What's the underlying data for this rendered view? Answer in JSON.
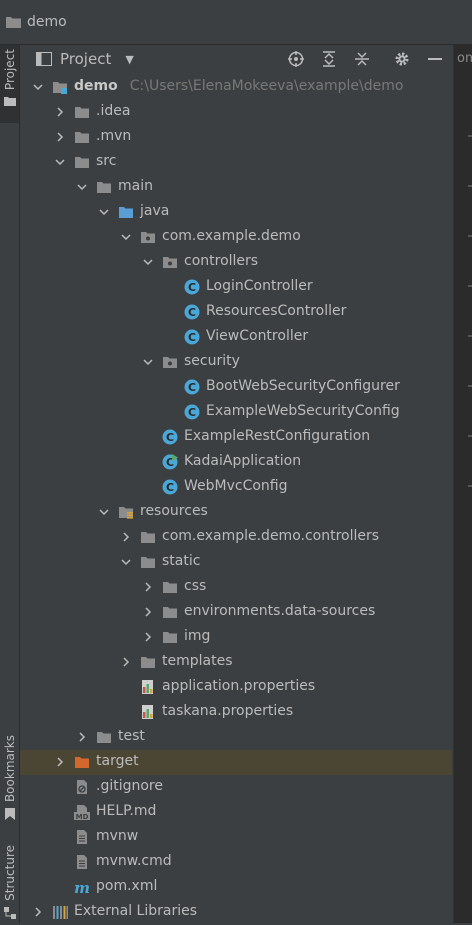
{
  "window": {
    "title": "demo"
  },
  "sidebar": {
    "project_label": "Project",
    "bookmarks_label": "Bookmarks",
    "structure_label": "Structure"
  },
  "panel": {
    "title": "Project"
  },
  "editor": {
    "tab_text": "om"
  },
  "tree": [
    {
      "label": "demo",
      "path": "C:\\Users\\ElenaMokeeva\\example\\demo",
      "icon": "module-folder-icon",
      "depth": 0,
      "arrow": "down",
      "bold": true
    },
    {
      "label": ".idea",
      "icon": "folder-icon",
      "depth": 1,
      "arrow": "right"
    },
    {
      "label": ".mvn",
      "icon": "folder-icon",
      "depth": 1,
      "arrow": "right"
    },
    {
      "label": "src",
      "icon": "folder-icon",
      "depth": 1,
      "arrow": "down"
    },
    {
      "label": "main",
      "icon": "folder-icon",
      "depth": 2,
      "arrow": "down"
    },
    {
      "label": "java",
      "icon": "source-folder-icon",
      "depth": 3,
      "arrow": "down"
    },
    {
      "label": "com.example.demo",
      "icon": "package-icon",
      "depth": 4,
      "arrow": "down"
    },
    {
      "label": "controllers",
      "icon": "package-icon",
      "depth": 5,
      "arrow": "down"
    },
    {
      "label": "LoginController",
      "icon": "java-class-icon",
      "depth": 6,
      "arrow": "none"
    },
    {
      "label": "ResourcesController",
      "icon": "java-class-icon",
      "depth": 6,
      "arrow": "none"
    },
    {
      "label": "ViewController",
      "icon": "java-class-icon",
      "depth": 6,
      "arrow": "none"
    },
    {
      "label": "security",
      "icon": "package-icon",
      "depth": 5,
      "arrow": "down"
    },
    {
      "label": "BootWebSecurityConfigurer",
      "icon": "java-class-icon",
      "depth": 6,
      "arrow": "none"
    },
    {
      "label": "ExampleWebSecurityConfig",
      "icon": "java-class-icon",
      "depth": 6,
      "arrow": "none"
    },
    {
      "label": "ExampleRestConfiguration",
      "icon": "java-class-icon",
      "depth": 5,
      "arrow": "none"
    },
    {
      "label": "KadaiApplication",
      "icon": "java-run-class-icon",
      "depth": 5,
      "arrow": "none"
    },
    {
      "label": "WebMvcConfig",
      "icon": "java-class-icon",
      "depth": 5,
      "arrow": "none"
    },
    {
      "label": "resources",
      "icon": "resources-folder-icon",
      "depth": 3,
      "arrow": "down"
    },
    {
      "label": "com.example.demo.controllers",
      "icon": "folder-icon",
      "depth": 4,
      "arrow": "right"
    },
    {
      "label": "static",
      "icon": "folder-icon",
      "depth": 4,
      "arrow": "down"
    },
    {
      "label": "css",
      "icon": "folder-icon",
      "depth": 5,
      "arrow": "right"
    },
    {
      "label": "environments.data-sources",
      "icon": "folder-icon",
      "depth": 5,
      "arrow": "right"
    },
    {
      "label": "img",
      "icon": "folder-icon",
      "depth": 5,
      "arrow": "right"
    },
    {
      "label": "templates",
      "icon": "folder-icon",
      "depth": 4,
      "arrow": "right"
    },
    {
      "label": "application.properties",
      "icon": "properties-file-icon",
      "depth": 4,
      "arrow": "none"
    },
    {
      "label": "taskana.properties",
      "icon": "properties-file-icon",
      "depth": 4,
      "arrow": "none"
    },
    {
      "label": "test",
      "icon": "folder-icon",
      "depth": 2,
      "arrow": "right"
    },
    {
      "label": "target",
      "icon": "excluded-folder-icon",
      "depth": 1,
      "arrow": "right",
      "highlight": true
    },
    {
      "label": ".gitignore",
      "icon": "gitignore-file-icon",
      "depth": 1,
      "arrow": "none"
    },
    {
      "label": "HELP.md",
      "icon": "markdown-file-icon",
      "depth": 1,
      "arrow": "none"
    },
    {
      "label": "mvnw",
      "icon": "text-file-icon",
      "depth": 1,
      "arrow": "none"
    },
    {
      "label": "mvnw.cmd",
      "icon": "text-file-icon",
      "depth": 1,
      "arrow": "none"
    },
    {
      "label": "pom.xml",
      "icon": "maven-file-icon",
      "depth": 1,
      "arrow": "none"
    },
    {
      "label": "External Libraries",
      "icon": "libraries-icon",
      "depth": 0,
      "arrow": "right"
    }
  ],
  "colors": {
    "folder": "#8c8c8c",
    "source_folder": "#5b9ed6",
    "java_class": "#4aa8d8",
    "excluded_folder": "#d3682f",
    "highlight_row": "#4b4533"
  }
}
